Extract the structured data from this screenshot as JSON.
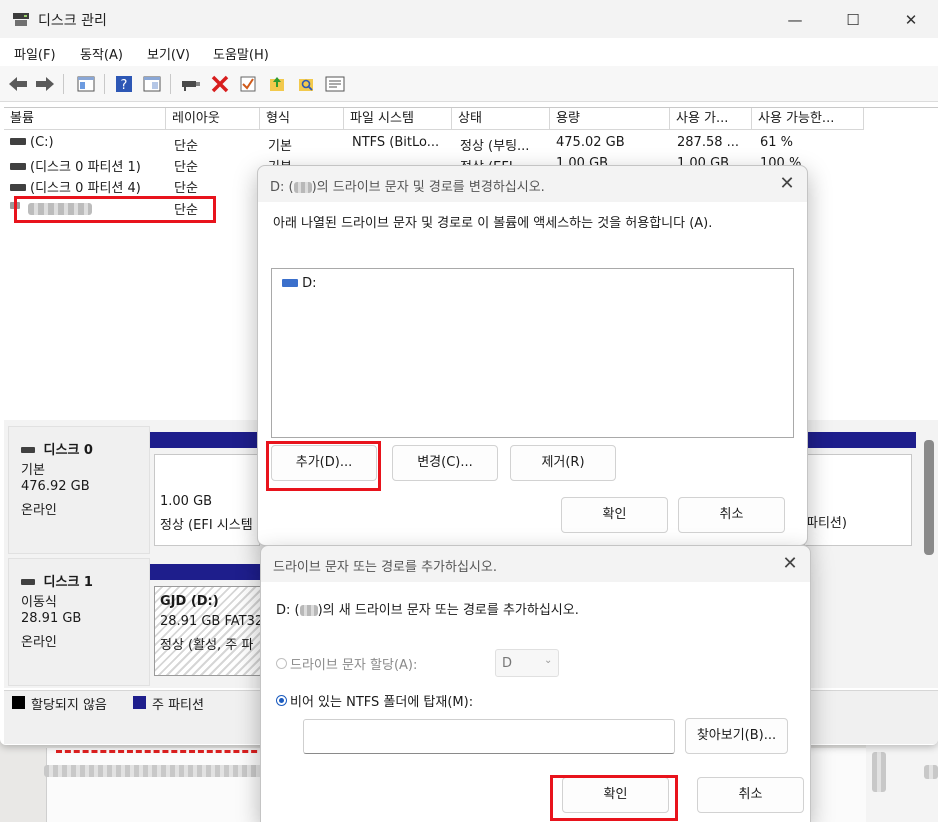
{
  "window": {
    "title": "디스크 관리",
    "minimize": "—",
    "maximize": "☐",
    "close": "✕"
  },
  "menu": {
    "file": "파일(F)",
    "action": "동작(A)",
    "view": "보기(V)",
    "help": "도움말(H)"
  },
  "toolbar_icons": [
    "back-icon",
    "forward-icon",
    "properties-icon",
    "help-icon",
    "console-tree-icon",
    "connect-icon",
    "delete-icon",
    "check-icon",
    "folder-up-icon",
    "search-folder-icon",
    "list-icon"
  ],
  "volume_table": {
    "columns": [
      "볼륨",
      "레이아웃",
      "형식",
      "파일 시스템",
      "상태",
      "용량",
      "사용 가...",
      "사용 가능한..."
    ],
    "rows": [
      [
        "(C:)",
        "단순",
        "기본",
        "NTFS (BitLo...",
        "정상 (부팅...",
        "475.02 GB",
        "287.58 ...",
        "61 %"
      ],
      [
        "(디스크 0 파티션 1)",
        "단순",
        "기본",
        "",
        "정상 (EFI...",
        "1.00 GB",
        "1.00 GB",
        "100 %"
      ],
      [
        "(디스크 0 파티션 4)",
        "단순",
        "",
        "",
        "",
        "",
        "",
        ""
      ],
      [
        "",
        "단순",
        "",
        "",
        "",
        "",
        "",
        ""
      ]
    ]
  },
  "disks": [
    {
      "name": "디스크 0",
      "type": "기본",
      "size": "476.92 GB",
      "status": "온라인",
      "partitions": [
        {
          "size": "1.00 GB",
          "status": "정상 (EFI 시스템"
        },
        {
          "status": "파티션)"
        }
      ]
    },
    {
      "name": "디스크 1",
      "type": "이동식",
      "size": "28.91 GB",
      "status": "온라인",
      "partitions": [
        {
          "label": "GJD  (D:)",
          "size": "28.91 GB FAT32",
          "status": "정상 (활성, 주 파"
        }
      ]
    }
  ],
  "legend": {
    "unallocated": "할당되지 않음",
    "primary": "주 파티션"
  },
  "change_dialog": {
    "title_prefix": "D: (",
    "title_suffix": ")의 드라이브 문자 및 경로를 변경하십시오.",
    "description": "아래 나열된 드라이브 문자 및 경로로 이 볼륨에 액세스하는 것을 허용합니다 (A).",
    "list_items": [
      "D:"
    ],
    "add": "추가(D)...",
    "change": "변경(C)...",
    "remove": "제거(R)",
    "ok": "확인",
    "cancel": "취소",
    "close": "✕"
  },
  "add_dialog": {
    "title": "드라이브 문자 또는 경로를 추가하십시오.",
    "description_prefix": "D: (",
    "description_suffix": ")의 새 드라이브 문자 또는 경로를 추가하십시오.",
    "assign_letter": "드라이브 문자 할당(A):",
    "letter_value": "D",
    "mount_folder": "비어 있는 NTFS 폴더에 탑재(M):",
    "folder_value": "",
    "browse": "찾아보기(B)...",
    "ok": "확인",
    "cancel": "취소",
    "close": "✕"
  },
  "colors": {
    "primary_partition": "#1e1e8c",
    "unallocated": "#000000",
    "highlight": "#e8131c",
    "radio_selected": "#1c5cbf"
  }
}
